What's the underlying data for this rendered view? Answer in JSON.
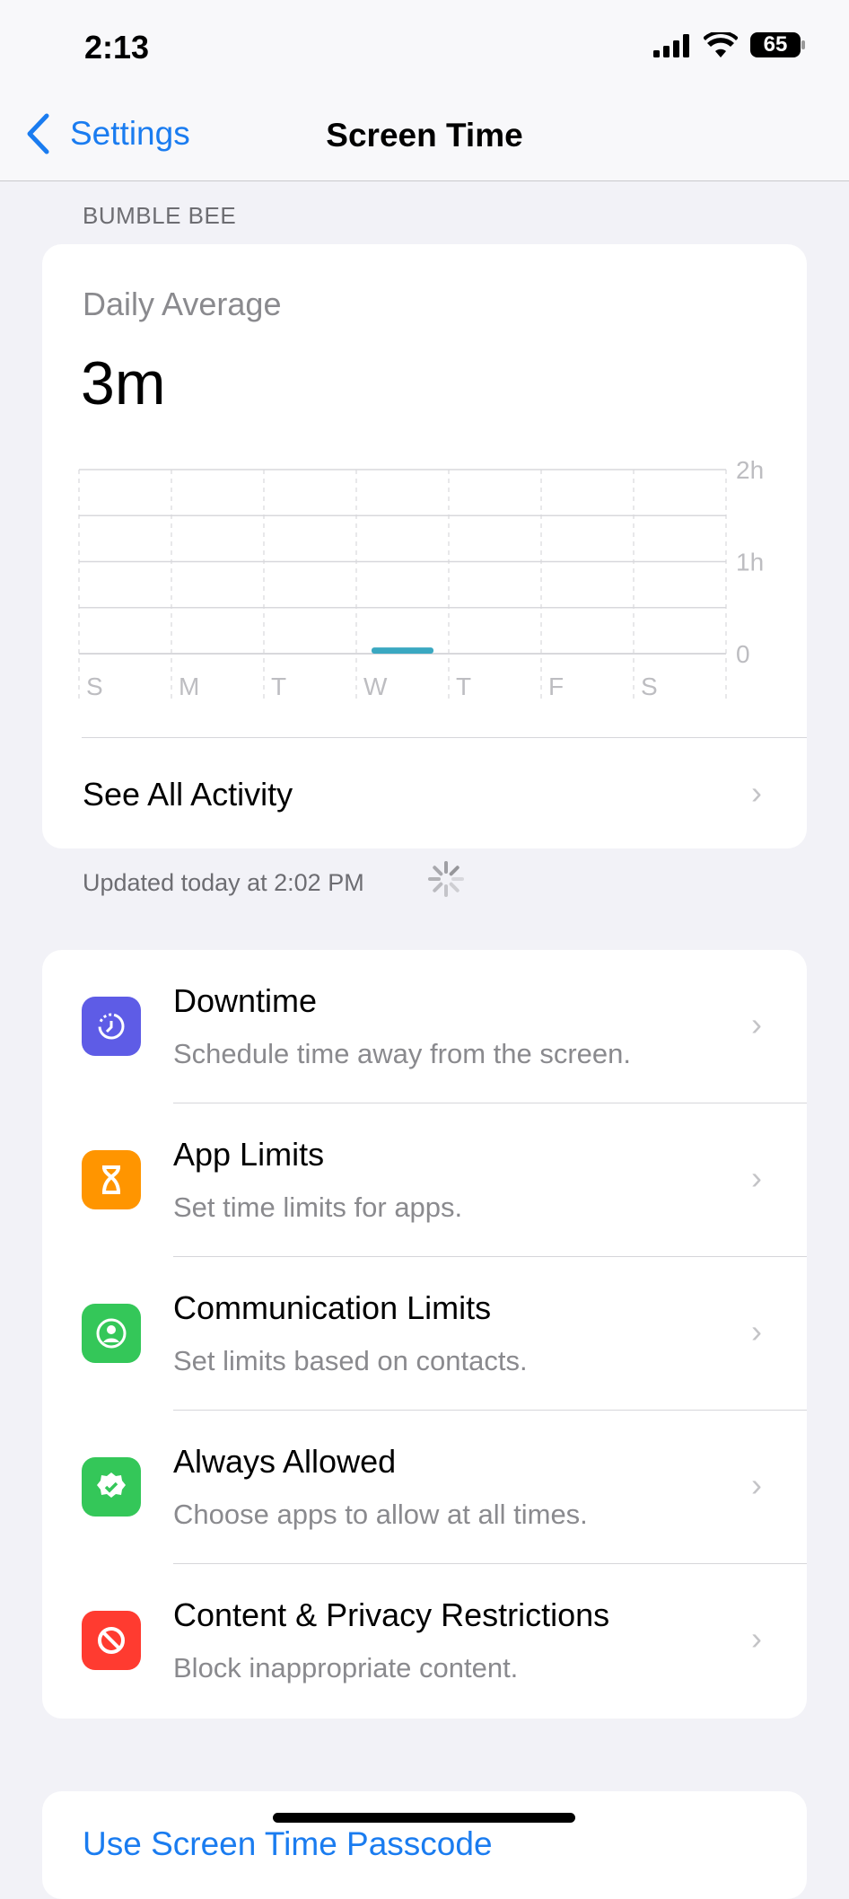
{
  "status_bar": {
    "time": "2:13",
    "battery": "65"
  },
  "nav": {
    "back_label": "Settings",
    "title": "Screen Time"
  },
  "section_header": "BUMBLE BEE",
  "summary": {
    "label": "Daily Average",
    "value": "3m",
    "see_all": "See All Activity",
    "updated": "Updated today at 2:02 PM"
  },
  "chart_data": {
    "type": "bar",
    "categories": [
      "S",
      "M",
      "T",
      "W",
      "T",
      "F",
      "S"
    ],
    "values_minutes": [
      0,
      0,
      0,
      4,
      0,
      0,
      0
    ],
    "y_ticks": [
      "2h",
      "1h",
      "0"
    ],
    "ylim_minutes": [
      0,
      120
    ],
    "grid": true,
    "bar_color": "#3aa8c1"
  },
  "items": [
    {
      "title": "Downtime",
      "subtitle": "Schedule time away from the screen.",
      "icon": "downtime-icon",
      "color": "#5e5ce6"
    },
    {
      "title": "App Limits",
      "subtitle": "Set time limits for apps.",
      "icon": "hourglass-icon",
      "color": "#ff9500"
    },
    {
      "title": "Communication Limits",
      "subtitle": "Set limits based on contacts.",
      "icon": "person-circle-icon",
      "color": "#34c759"
    },
    {
      "title": "Always Allowed",
      "subtitle": "Choose apps to allow at all times.",
      "icon": "checkmark-seal-icon",
      "color": "#34c759"
    },
    {
      "title": "Content & Privacy Restrictions",
      "subtitle": "Block inappropriate content.",
      "icon": "prohibited-icon",
      "color": "#ff3b30"
    }
  ],
  "passcode_link": "Use Screen Time Passcode"
}
